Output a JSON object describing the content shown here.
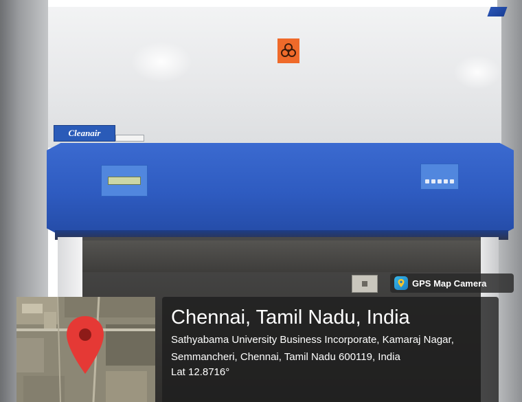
{
  "brand": "Cleanair",
  "gps_overlay": {
    "app_name": "GPS Map Camera",
    "location_title": "Chennai, Tamil Nadu, India",
    "address": "Sathyabama University Business Incorporate, Kamaraj Nagar, Semmancheri, Chennai, Tamil Nadu 600119, India",
    "coordinates": "Lat 12.8716°",
    "app_icon": "map-pin-icon",
    "map_marker_color": "#e53935"
  },
  "colors": {
    "cabinet_blue": "#2e5bc0",
    "biohazard_orange": "#ef6a2a",
    "overlay_background": "#1e1e1e"
  }
}
